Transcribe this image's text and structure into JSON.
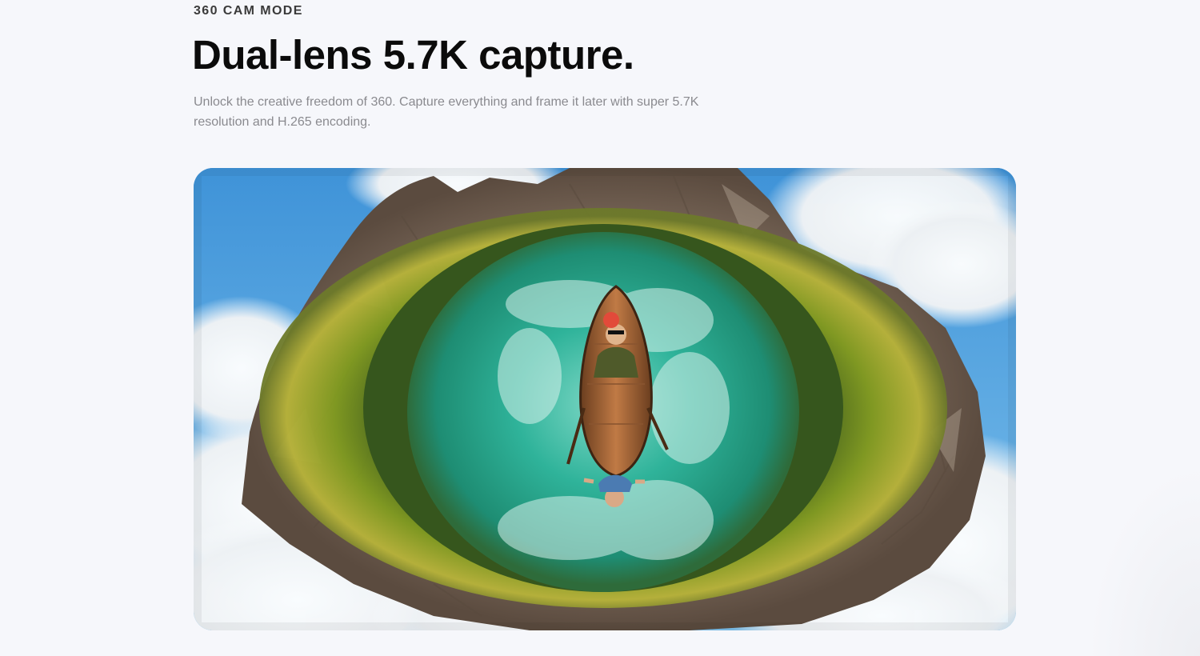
{
  "section": {
    "eyebrow": "360 CAM MODE",
    "headline": "Dual-lens 5.7K capture.",
    "description": "Unlock the creative freedom of 360. Capture everything and frame it later with super 5.7K resolution and H.265 encoding."
  },
  "colors": {
    "page_background": "#f6f7fb",
    "headline": "#0b0b0b",
    "eyebrow": "#3a3a3a",
    "description": "#8a8a8f",
    "sky": "#4f9fdc",
    "water": "#2fb39a",
    "forest": "#6f8c1e",
    "rock": "#8b7766"
  }
}
